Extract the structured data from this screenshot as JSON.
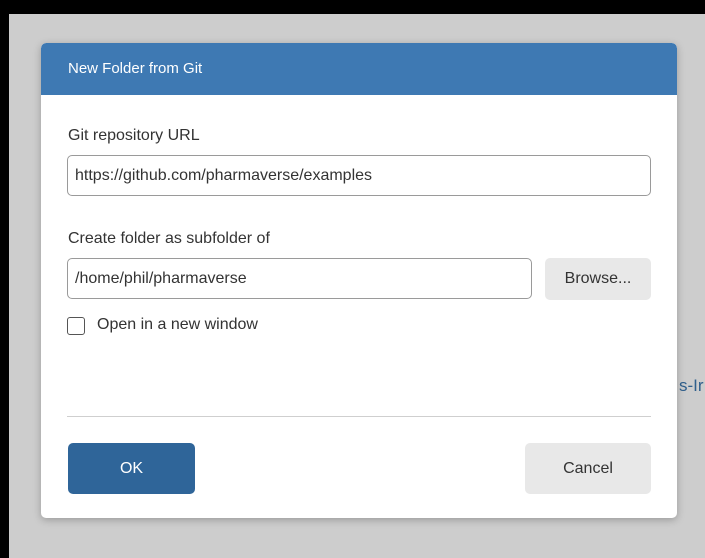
{
  "background": {
    "partial_text": "s-Ir"
  },
  "dialog": {
    "title": "New Folder from Git",
    "repo_url_label": "Git repository URL",
    "repo_url_value": "https://github.com/pharmaverse/examples",
    "subfolder_label": "Create folder as subfolder of",
    "subfolder_value": "/home/phil/pharmaverse",
    "browse_label": "Browse...",
    "new_window_label": "Open in a new window",
    "new_window_checked": false,
    "ok_label": "OK",
    "cancel_label": "Cancel"
  },
  "colors": {
    "titlebar": "#3e79b3",
    "ok_button": "#2f6599",
    "secondary_button": "#e8e8e8",
    "backdrop": "#cdcdcd"
  }
}
